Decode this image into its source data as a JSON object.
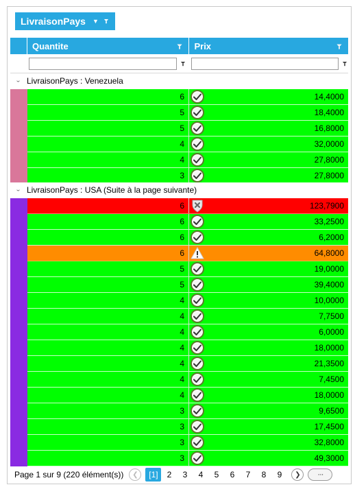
{
  "grouping": {
    "chip_label": "LivraisonPays"
  },
  "columns": {
    "quantite": "Quantite",
    "prix": "Prix"
  },
  "filters": {
    "quantite_value": "",
    "prix_value": ""
  },
  "colors": {
    "accent": "#28a8e0",
    "ok": "#00ff00",
    "error": "#ff0000",
    "warning": "#ff8c00",
    "group_venezuela": "#d9779a",
    "group_usa": "#8a2be2"
  },
  "groups": [
    {
      "label": "LivraisonPays : Venezuela",
      "rows": [
        {
          "quantite": "6",
          "prix": "14,4000",
          "status": "ok"
        },
        {
          "quantite": "5",
          "prix": "18,4000",
          "status": "ok"
        },
        {
          "quantite": "5",
          "prix": "16,8000",
          "status": "ok"
        },
        {
          "quantite": "4",
          "prix": "32,0000",
          "status": "ok"
        },
        {
          "quantite": "4",
          "prix": "27,8000",
          "status": "ok"
        },
        {
          "quantite": "3",
          "prix": "27,8000",
          "status": "ok"
        }
      ]
    },
    {
      "label": "LivraisonPays : USA (Suite à la page suivante)",
      "rows": [
        {
          "quantite": "6",
          "prix": "123,7900",
          "status": "error"
        },
        {
          "quantite": "6",
          "prix": "33,2500",
          "status": "ok"
        },
        {
          "quantite": "6",
          "prix": "6,2000",
          "status": "ok"
        },
        {
          "quantite": "6",
          "prix": "64,8000",
          "status": "warning"
        },
        {
          "quantite": "5",
          "prix": "19,0000",
          "status": "ok"
        },
        {
          "quantite": "5",
          "prix": "39,4000",
          "status": "ok"
        },
        {
          "quantite": "4",
          "prix": "10,0000",
          "status": "ok"
        },
        {
          "quantite": "4",
          "prix": "7,7500",
          "status": "ok"
        },
        {
          "quantite": "4",
          "prix": "6,0000",
          "status": "ok"
        },
        {
          "quantite": "4",
          "prix": "18,0000",
          "status": "ok"
        },
        {
          "quantite": "4",
          "prix": "21,3500",
          "status": "ok"
        },
        {
          "quantite": "4",
          "prix": "7,4500",
          "status": "ok"
        },
        {
          "quantite": "4",
          "prix": "18,0000",
          "status": "ok"
        },
        {
          "quantite": "3",
          "prix": "9,6500",
          "status": "ok"
        },
        {
          "quantite": "3",
          "prix": "17,4500",
          "status": "ok"
        },
        {
          "quantite": "3",
          "prix": "32,8000",
          "status": "ok"
        },
        {
          "quantite": "3",
          "prix": "49,3000",
          "status": "ok"
        }
      ]
    }
  ],
  "pager": {
    "summary": "Page 1 sur 9 (220 élément(s))",
    "pages": [
      "[1]",
      "2",
      "3",
      "4",
      "5",
      "6",
      "7",
      "8",
      "9"
    ],
    "active_index": 0,
    "more_label": "···"
  },
  "icons": {
    "prev": "chevron-left-icon",
    "next": "chevron-right-icon",
    "ok": "check-circle-icon",
    "error": "shield-x-icon",
    "warning": "warning-triangle-icon",
    "filter": "pin-icon",
    "dropdown": "caret-down-icon",
    "expand": "chevron-down-icon"
  }
}
